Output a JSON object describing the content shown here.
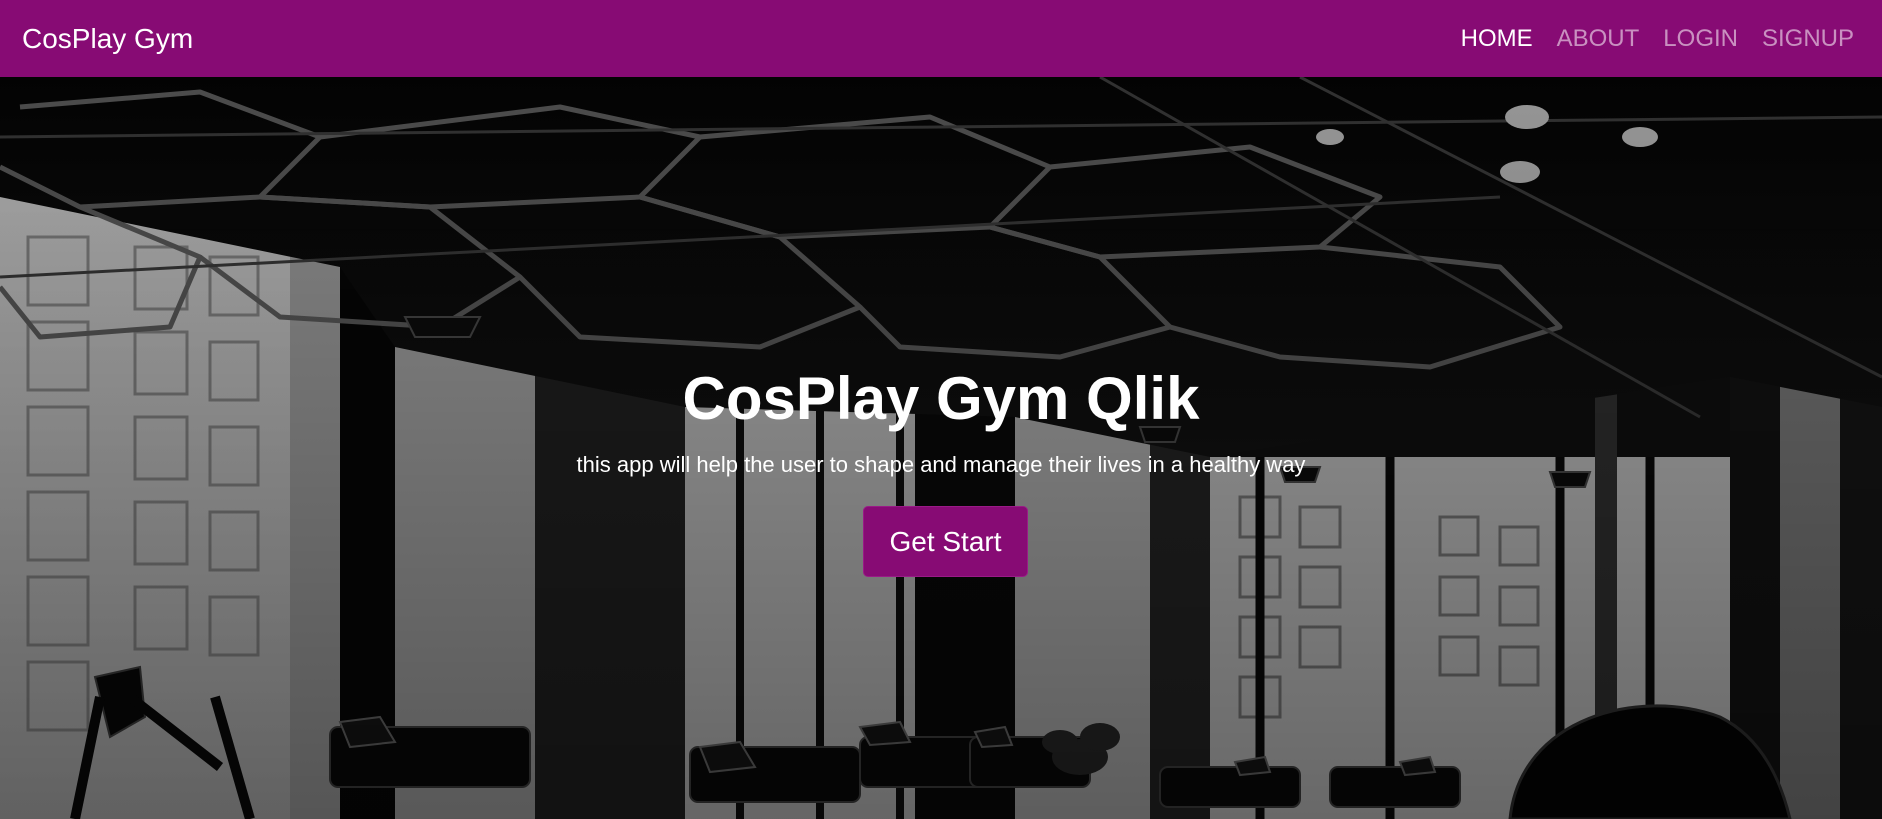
{
  "navbar": {
    "brand": "CosPlay Gym",
    "links": [
      {
        "label": "HOME",
        "active": true
      },
      {
        "label": "ABOUT",
        "active": false
      },
      {
        "label": "LOGIN",
        "active": false
      },
      {
        "label": "SIGNUP",
        "active": false
      }
    ],
    "color": "#870b74"
  },
  "hero": {
    "title": "CosPlay Gym Qlik",
    "subtitle": "this app will help the user to shape and manage their lives in a healthy way",
    "cta_label": "Get Start",
    "background": "black-and-white gym interior photo with treadmills and city windows"
  }
}
